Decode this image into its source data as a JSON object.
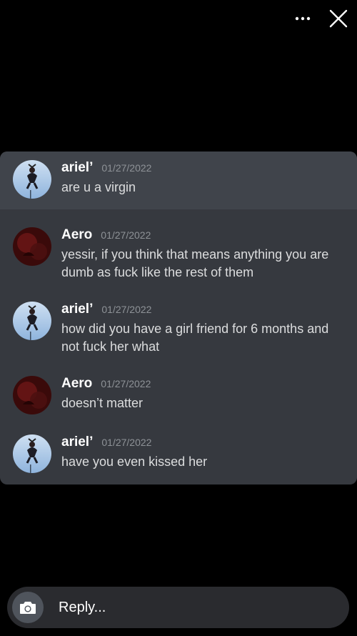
{
  "header": {
    "more_icon": "more-horizontal-icon",
    "close_icon": "close-x-icon"
  },
  "messages": [
    {
      "author": "ariel’",
      "timestamp": "01/27/2022",
      "text": "are u a virgin",
      "avatar": "avatar-ariel",
      "highlighted": true
    },
    {
      "author": "Aero",
      "timestamp": "01/27/2022",
      "text": "yessir, if you think that means anything you are dumb as fuck like the rest of them",
      "avatar": "avatar-aero",
      "highlighted": false
    },
    {
      "author": "ariel’",
      "timestamp": "01/27/2022",
      "text": "how did you have a girl friend for 6 months and not fuck her what",
      "avatar": "avatar-ariel",
      "highlighted": false
    },
    {
      "author": "Aero",
      "timestamp": "01/27/2022",
      "text": "doesn’t matter",
      "avatar": "avatar-aero",
      "highlighted": false
    },
    {
      "author": "ariel’",
      "timestamp": "01/27/2022",
      "text": "have you even kissed her",
      "avatar": "avatar-ariel",
      "highlighted": false
    }
  ],
  "reply": {
    "placeholder": "Reply...",
    "camera_icon": "camera-icon"
  },
  "colors": {
    "background": "#000000",
    "card": "#36393f",
    "highlight": "#40444b",
    "author": "#ffffff",
    "timestamp": "#8e9297",
    "text": "#dcddde"
  }
}
